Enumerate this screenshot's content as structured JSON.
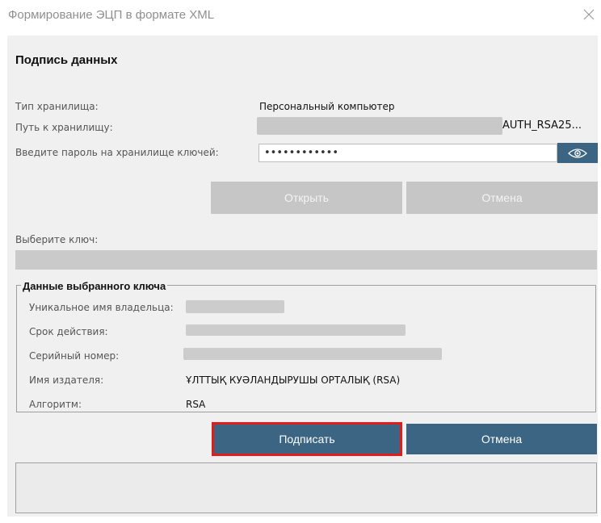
{
  "window": {
    "title": "Формирование ЭЦП в формате XML"
  },
  "section": {
    "heading": "Подпись данных"
  },
  "storage": {
    "type_label": "Тип хранилища:",
    "type_value": "Персональный компьютер",
    "path_label": "Путь к хранилищу:",
    "path_value_visible": "AUTH_RSA25...",
    "password_label": "Введите пароль на хранилище ключей:",
    "password_value": "••••••••••••"
  },
  "buttons": {
    "open": "Открыть",
    "cancel_top": "Отмена",
    "sign": "Подписать",
    "cancel_bottom": "Отмена"
  },
  "key_select": {
    "label": "Выберите ключ:"
  },
  "key_details": {
    "legend": "Данные выбранного ключа",
    "owner_label": "Уникальное имя владельца:",
    "validity_label": "Срок действия:",
    "serial_label": "Серийный номер:",
    "issuer_label": "Имя издателя:",
    "issuer_value": "ҰЛТТЫҚ КУӘЛАНДЫРУШЫ ОРТАЛЫҚ (RSA)",
    "algorithm_label": "Алгоритм:",
    "algorithm_value": "RSA"
  },
  "colors": {
    "accent": "#3b6583",
    "highlight_border": "#e21b1b",
    "panel_bg": "#f0f0f0"
  },
  "icons": {
    "close": "close-icon",
    "eye": "eye-icon"
  }
}
